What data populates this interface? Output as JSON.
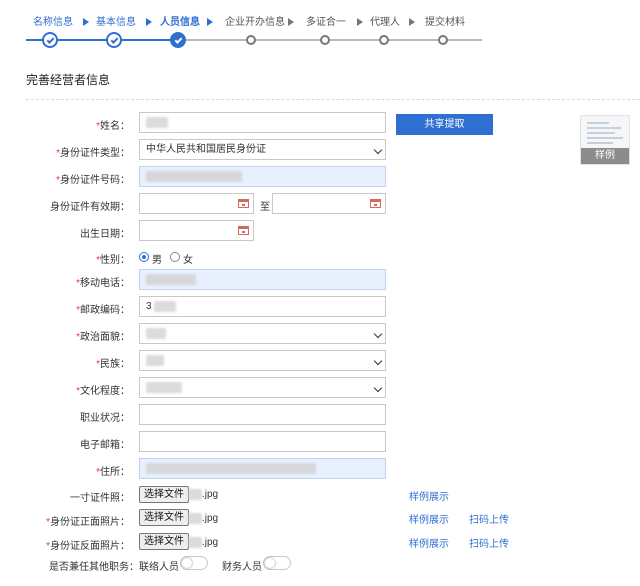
{
  "steps": [
    {
      "label": "名称信息",
      "state": "done"
    },
    {
      "label": "基本信息",
      "state": "done"
    },
    {
      "label": "人员信息",
      "state": "active"
    },
    {
      "label": "企业开办信息",
      "state": "todo"
    },
    {
      "label": "多证合一",
      "state": "todo"
    },
    {
      "label": "代理人",
      "state": "todo"
    },
    {
      "label": "提交材料",
      "state": "todo"
    }
  ],
  "section": {
    "title": "完善经营者信息"
  },
  "colors": {
    "primary": "#2f6fd1",
    "required": "#e33333",
    "filled_field": "#e8f0fe"
  },
  "form": {
    "name": {
      "required": "*",
      "label": "姓名："
    },
    "share_button": "共享提取",
    "sample_thumb": {
      "caption": "样例"
    },
    "id_type": {
      "required": "*",
      "label": "身份证件类型：",
      "value": "中华人民共和国居民身份证"
    },
    "id_number": {
      "required": "*",
      "label": "身份证件号码："
    },
    "id_validity": {
      "label": "身份证件有效期：",
      "to": "至"
    },
    "birth_date": {
      "label": "出生日期："
    },
    "gender": {
      "required": "*",
      "label": "性别：",
      "male": "男",
      "female": "女",
      "selected": "男"
    },
    "mobile": {
      "required": "*",
      "label": "移动电话："
    },
    "postcode": {
      "required": "*",
      "label": "邮政编码：",
      "value_prefix": "3"
    },
    "political": {
      "required": "*",
      "label": "政治面貌："
    },
    "ethnicity": {
      "required": "*",
      "label": "民族："
    },
    "education": {
      "required": "*",
      "label": "文化程度："
    },
    "occupation": {
      "label": "职业状况："
    },
    "email": {
      "label": "电子邮箱："
    },
    "address": {
      "required": "*",
      "label": "住所："
    },
    "photo_1inch": {
      "label": "一寸证件照：",
      "button": "选择文件",
      "file_ext": ".jpg",
      "sample_link": "样例展示"
    },
    "id_front": {
      "required": "*",
      "label": "身份证正面照片：",
      "button": "选择文件",
      "file_ext": ".jpg",
      "sample_link": "样例展示",
      "scan_link": "扫码上传"
    },
    "id_back": {
      "required": "*",
      "label": "身份证反面照片：",
      "button": "选择文件",
      "file_ext": ".jpg",
      "sample_link": "样例展示",
      "scan_link": "扫码上传"
    },
    "other_duties": {
      "label": "是否兼任其他职务：",
      "liaison": "联络人员",
      "finance": "财务人员"
    }
  }
}
